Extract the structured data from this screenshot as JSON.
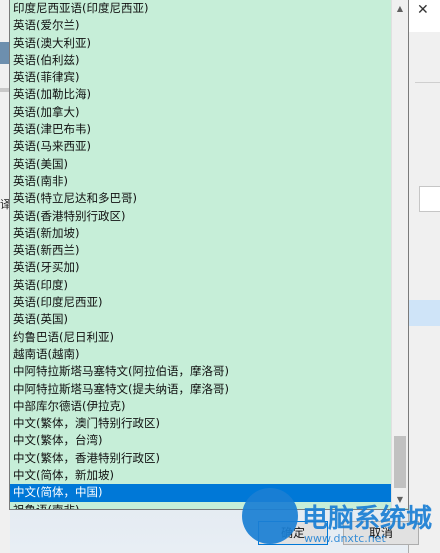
{
  "languages": [
    {
      "label": "印度尼西亚语(印度尼西亚)",
      "selected": false
    },
    {
      "label": "英语(爱尔兰)",
      "selected": false
    },
    {
      "label": "英语(澳大利亚)",
      "selected": false
    },
    {
      "label": "英语(伯利兹)",
      "selected": false
    },
    {
      "label": "英语(菲律宾)",
      "selected": false
    },
    {
      "label": "英语(加勒比海)",
      "selected": false
    },
    {
      "label": "英语(加拿大)",
      "selected": false
    },
    {
      "label": "英语(津巴布韦)",
      "selected": false
    },
    {
      "label": "英语(马来西亚)",
      "selected": false
    },
    {
      "label": "英语(美国)",
      "selected": false
    },
    {
      "label": "英语(南非)",
      "selected": false
    },
    {
      "label": "英语(特立尼达和多巴哥)",
      "selected": false
    },
    {
      "label": "英语(香港特别行政区)",
      "selected": false
    },
    {
      "label": "英语(新加坡)",
      "selected": false
    },
    {
      "label": "英语(新西兰)",
      "selected": false
    },
    {
      "label": "英语(牙买加)",
      "selected": false
    },
    {
      "label": "英语(印度)",
      "selected": false
    },
    {
      "label": "英语(印度尼西亚)",
      "selected": false
    },
    {
      "label": "英语(英国)",
      "selected": false
    },
    {
      "label": "约鲁巴语(尼日利亚)",
      "selected": false
    },
    {
      "label": "越南语(越南)",
      "selected": false
    },
    {
      "label": "中阿特拉斯塔马塞特文(阿拉伯语，摩洛哥)",
      "selected": false
    },
    {
      "label": "中阿特拉斯塔马塞特文(提夫纳语，摩洛哥)",
      "selected": false
    },
    {
      "label": "中部库尔德语(伊拉克)",
      "selected": false
    },
    {
      "label": "中文(繁体，澳门特别行政区)",
      "selected": false
    },
    {
      "label": "中文(繁体，台湾)",
      "selected": false
    },
    {
      "label": "中文(繁体，香港特别行政区)",
      "selected": false
    },
    {
      "label": "中文(简体，新加坡)",
      "selected": false
    },
    {
      "label": "中文(简体，中国)",
      "selected": true
    },
    {
      "label": "祖鲁语(南非)",
      "selected": false
    }
  ],
  "dialog": {
    "ok_label": "确定",
    "cancel_label": "取消",
    "left_fragment": "译"
  },
  "watermark": {
    "text": "电脑系统城",
    "sub": "www.dnxtc.net"
  },
  "colors": {
    "list_background": "#c6eed8",
    "selection": "#0078d7",
    "watermark": "#1a7fd4"
  }
}
